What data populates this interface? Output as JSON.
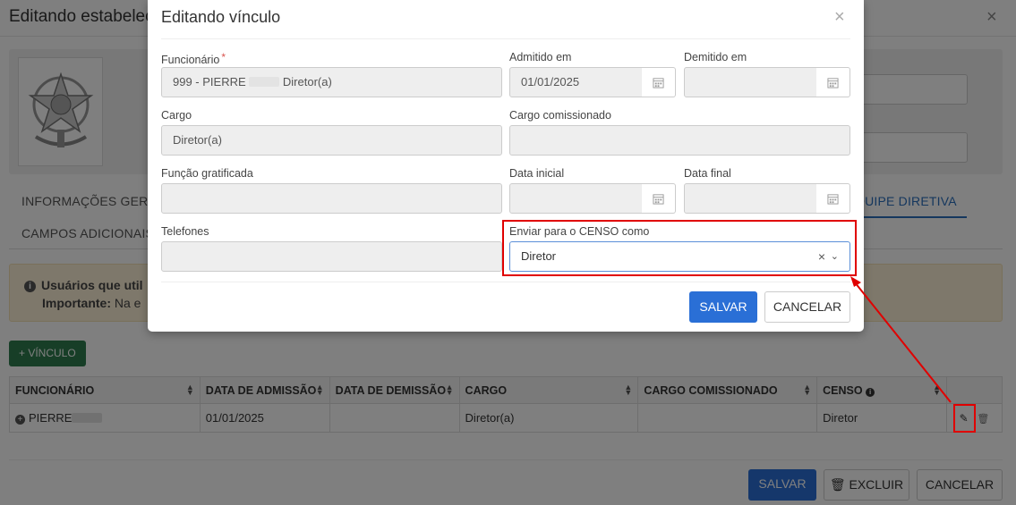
{
  "background": {
    "title": "Editando estabelec",
    "close": "×",
    "tabs": {
      "info": "INFORMAÇÕES GERAI",
      "extra": "CAMPOS ADICIONAIS",
      "active": "QUIPE DIRETIVA"
    },
    "alert": {
      "line1": "Usuários que util",
      "line2_bold": "Importante:",
      "line2_text": " Na e"
    },
    "add_button": "+ VÍNCULO",
    "table": {
      "headers": [
        "FUNCIONÁRIO",
        "DATA DE ADMISSÃO",
        "DATA DE DEMISSÃO",
        "CARGO",
        "CARGO COMISSIONADO",
        "CENSO"
      ],
      "row": {
        "funcionario": "PIERRE",
        "admissao": "01/01/2025",
        "demissao": "",
        "cargo": "Diretor(a)",
        "cargo_comissionado": "",
        "censo": "Diretor"
      }
    },
    "buttons": {
      "save": "SALVAR",
      "delete": "EXCLUIR",
      "cancel": "CANCELAR"
    }
  },
  "modal": {
    "title": "Editando vínculo",
    "close": "×",
    "fields": {
      "funcionario": {
        "label": "Funcionário",
        "required": "*",
        "value_prefix": "999 - PIERRE",
        "value_suffix": "Diretor(a)"
      },
      "admitido": {
        "label": "Admitido em",
        "value": "01/01/2025"
      },
      "demitido": {
        "label": "Demitido em",
        "value": ""
      },
      "cargo": {
        "label": "Cargo",
        "value": "Diretor(a)"
      },
      "cargo_comissionado": {
        "label": "Cargo comissionado",
        "value": ""
      },
      "funcao_gratificada": {
        "label": "Função gratificada",
        "value": ""
      },
      "data_inicial": {
        "label": "Data inicial",
        "value": ""
      },
      "data_final": {
        "label": "Data final",
        "value": ""
      },
      "telefones": {
        "label": "Telefones",
        "value": ""
      },
      "censo": {
        "label": "Enviar para o CENSO como",
        "value": "Diretor",
        "clear": "×",
        "chevron": "⌄"
      }
    },
    "buttons": {
      "save": "SALVAR",
      "cancel": "CANCELAR"
    }
  },
  "colors": {
    "primary": "#2a6fd6",
    "success": "#2e7d4f",
    "annotation": "#e00000",
    "alert_bg": "#fcf0d6"
  }
}
